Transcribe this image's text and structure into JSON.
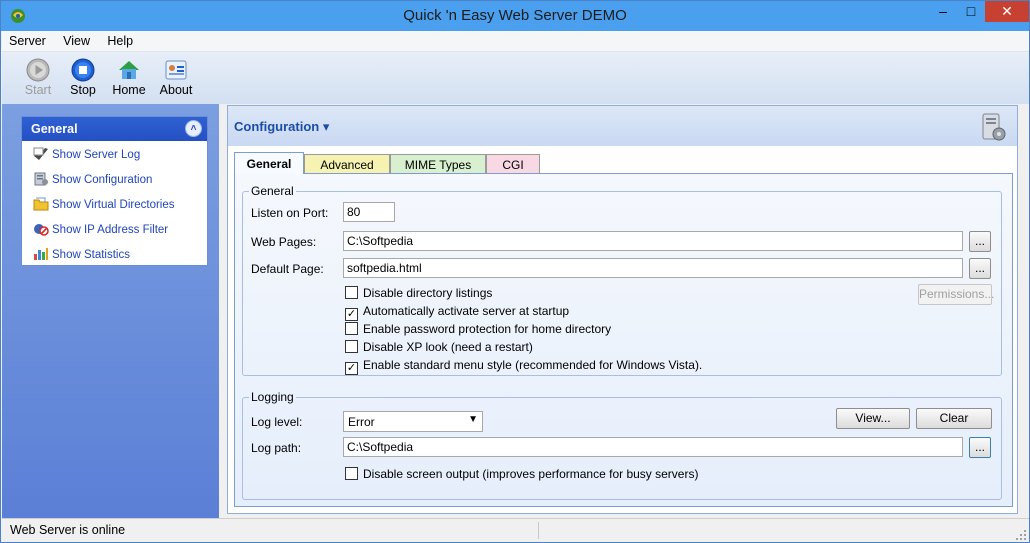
{
  "window": {
    "title": "Quick 'n Easy Web Server DEMO",
    "minimize": "–",
    "maximize": "□",
    "close": "✕"
  },
  "menu": {
    "items": [
      "Server",
      "View",
      "Help"
    ]
  },
  "toolbar": {
    "start": "Start",
    "stop": "Stop",
    "home": "Home",
    "about": "About"
  },
  "sidebar": {
    "header": "General",
    "collapse_glyph": "˄",
    "items": [
      {
        "label": "Show Server Log",
        "icon": "server-log-icon"
      },
      {
        "label": "Show Configuration",
        "icon": "configuration-icon"
      },
      {
        "label": "Show Virtual Directories",
        "icon": "folder-icon"
      },
      {
        "label": "Show IP Address Filter",
        "icon": "ip-filter-icon"
      },
      {
        "label": "Show Statistics",
        "icon": "statistics-icon"
      }
    ]
  },
  "config": {
    "title": "Configuration",
    "dropdown_glyph": "▾",
    "tabs": [
      "General",
      "Advanced",
      "MIME Types",
      "CGI"
    ],
    "general": {
      "group_label": "General",
      "listen_port_label": "Listen on Port:",
      "listen_port_value": "80",
      "web_pages_label": "Web Pages:",
      "web_pages_value": "C:\\Softpedia",
      "default_page_label": "Default Page:",
      "default_page_value": "softpedia.html",
      "browse_label": "...",
      "permissions_label": "Permissions...",
      "checkboxes": [
        {
          "label": "Disable directory listings",
          "checked": false
        },
        {
          "label": "Automatically activate server at startup",
          "checked": true
        },
        {
          "label": "Enable password protection for home directory",
          "checked": false
        },
        {
          "label": "Disable XP look (need a restart)",
          "checked": false
        },
        {
          "label": "Enable standard menu style (recommended for Windows Vista).",
          "checked": true
        }
      ]
    },
    "logging": {
      "group_label": "Logging",
      "log_level_label": "Log level:",
      "log_level_value": "Error",
      "view_label": "View...",
      "clear_label": "Clear",
      "log_path_label": "Log path:",
      "log_path_value": "C:\\Softpedia",
      "browse_label": "...",
      "disable_screen_output": {
        "label": "Disable screen output (improves performance for busy servers)",
        "checked": false
      }
    }
  },
  "status": {
    "text": "Web Server is online"
  },
  "colors": {
    "title_bar": "#4aa0ee",
    "close_button": "#c74132",
    "sidebar_header": "#2450c3",
    "link": "#2145b8",
    "config_title": "#1b4ea8",
    "tab_advanced": "#f6f3b2",
    "tab_mime": "#d8f0cf",
    "tab_cgi": "#f8d9e3"
  }
}
